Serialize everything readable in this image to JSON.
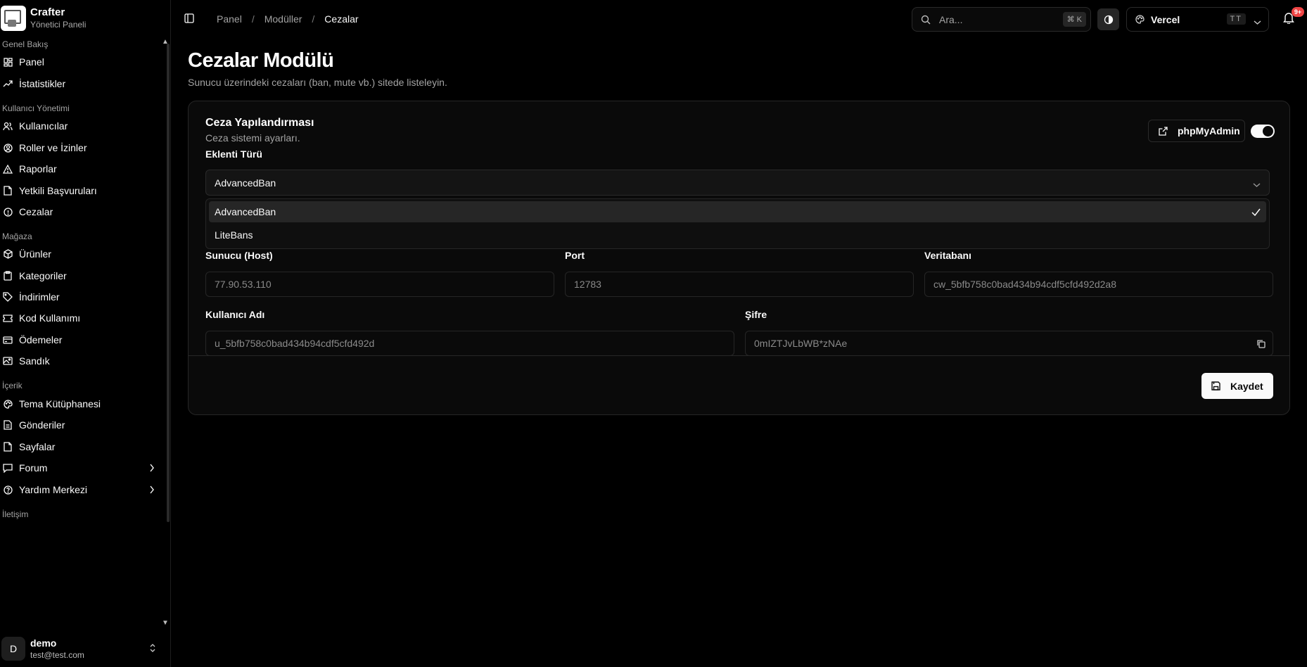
{
  "brand": {
    "name": "Crafter",
    "subtitle": "Yönetici Paneli"
  },
  "sidebar": {
    "sections": [
      {
        "label": "Genel Bakış",
        "items": [
          {
            "label": "Panel",
            "icon": "dashboard-icon"
          },
          {
            "label": "İstatistikler",
            "icon": "trending-up-icon"
          }
        ]
      },
      {
        "label": "Kullanıcı Yönetimi",
        "items": [
          {
            "label": "Kullanıcılar",
            "icon": "users-icon"
          },
          {
            "label": "Roller ve İzinler",
            "icon": "user-circle-icon"
          },
          {
            "label": "Raporlar",
            "icon": "warning-icon"
          },
          {
            "label": "Yetkili Başvuruları",
            "icon": "file-icon"
          },
          {
            "label": "Cezalar",
            "icon": "info-icon"
          }
        ]
      },
      {
        "label": "Mağaza",
        "items": [
          {
            "label": "Ürünler",
            "icon": "box-icon"
          },
          {
            "label": "Kategoriler",
            "icon": "clipboard-icon"
          },
          {
            "label": "İndirimler",
            "icon": "tag-icon"
          },
          {
            "label": "Kod Kullanımı",
            "icon": "ticket-icon"
          },
          {
            "label": "Ödemeler",
            "icon": "card-icon"
          },
          {
            "label": "Sandık",
            "icon": "image-icon"
          }
        ]
      },
      {
        "label": "İçerik",
        "items": [
          {
            "label": "Tema Kütüphanesi",
            "icon": "palette-icon"
          },
          {
            "label": "Gönderiler",
            "icon": "document-icon"
          },
          {
            "label": "Sayfalar",
            "icon": "page-icon"
          },
          {
            "label": "Forum",
            "icon": "message-icon"
          },
          {
            "label": "Yardım Merkezi",
            "icon": "help-icon"
          }
        ]
      },
      {
        "label": "İletişim",
        "items": []
      }
    ]
  },
  "user": {
    "initial": "D",
    "name": "demo",
    "email": "test@test.com"
  },
  "topbar": {
    "breadcrumb": [
      "Panel",
      "Modüller",
      "Cezalar"
    ],
    "search_placeholder": "Ara...",
    "search_shortcut": "⌘ K",
    "team_name": "Vercel",
    "team_badge": "TT",
    "notification_count": "9+"
  },
  "page": {
    "title": "Cezalar Modülü",
    "subtitle": "Sunucu üzerindeki cezaları (ban, mute vb.) sitede listeleyin."
  },
  "card": {
    "title": "Ceza Yapılandırması",
    "description": "Ceza sistemi ayarları.",
    "phpmyadmin_label": "phpMyAdmin",
    "toggle_on": true,
    "plugin_label": "Eklenti Türü",
    "plugin_value": "AdvancedBan",
    "plugin_options": [
      "AdvancedBan",
      "LiteBans"
    ],
    "host_label": "Sunucu (Host)",
    "host_value": "77.90.53.110",
    "port_label": "Port",
    "port_value": "12783",
    "db_label": "Veritabanı",
    "db_value": "cw_5bfb758c0bad434b94cdf5cfd492d2a8",
    "username_label": "Kullanıcı Adı",
    "username_value": "u_5bfb758c0bad434b94cdf5cfd492d",
    "password_label": "Şifre",
    "password_value": "0mIZTJvLbWB*zNAe",
    "save_label": "Kaydet"
  }
}
